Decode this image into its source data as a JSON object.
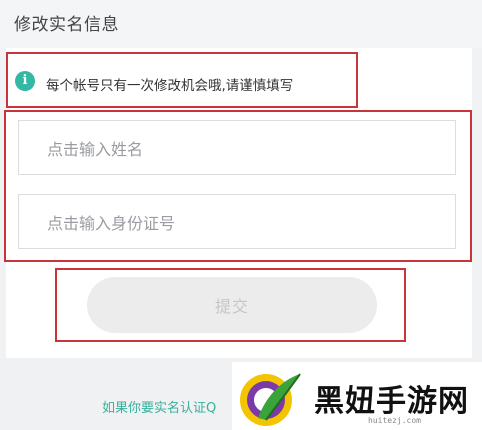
{
  "header": {
    "title": "修改实名信息"
  },
  "notice": {
    "icon": "info-icon",
    "text": "每个帐号只有一次修改机会哦,请谨慎填写"
  },
  "form": {
    "name_placeholder": "点击输入姓名",
    "id_placeholder": "点击输入身份证号",
    "submit_label": "提交"
  },
  "footer": {
    "link_text": "如果你要实名认证Q"
  },
  "watermark": {
    "text": "黑妞手游网",
    "url": "huitezj.com"
  },
  "colors": {
    "accent": "#33b8a6",
    "highlight_border": "#c8343a",
    "button_bg": "#ececec",
    "link": "#37b09c"
  }
}
